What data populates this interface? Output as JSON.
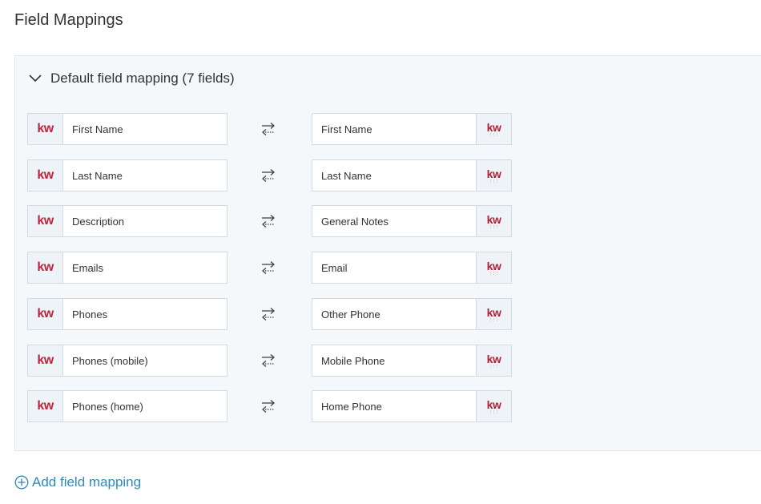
{
  "page": {
    "title": "Field Mappings"
  },
  "panel": {
    "title": "Default field mapping (7 fields)"
  },
  "logos": {
    "source": "kw",
    "target": "kw"
  },
  "mappings": [
    {
      "source": "First Name",
      "target": "First Name"
    },
    {
      "source": "Last Name",
      "target": "Last Name"
    },
    {
      "source": "Description",
      "target": "General Notes"
    },
    {
      "source": "Emails",
      "target": "Email"
    },
    {
      "source": "Phones",
      "target": "Other Phone"
    },
    {
      "source": "Phones (mobile)",
      "target": "Mobile Phone"
    },
    {
      "source": "Phones (home)",
      "target": "Home Phone"
    }
  ],
  "actions": {
    "add_mapping": "Add field mapping"
  },
  "colors": {
    "brand": "#c0243d",
    "link": "#2f8ab8",
    "panel_bg": "#f4f8fb"
  },
  "icons": {
    "collapse": "chevron-down-icon",
    "swap": "swap-arrows-icon",
    "add": "plus-circle-icon"
  }
}
